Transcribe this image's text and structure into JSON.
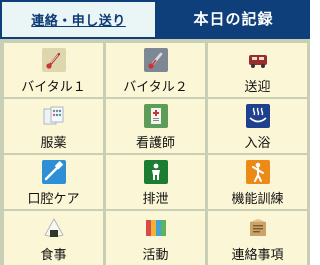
{
  "tabs": {
    "contact": "連絡・申し送り",
    "today_record": "本日の記録"
  },
  "grid": {
    "items": [
      {
        "label": "バイタル１",
        "icon": "thermometer-icon"
      },
      {
        "label": "バイタル２",
        "icon": "thermometer-icon"
      },
      {
        "label": "送迎",
        "icon": "car-icon"
      },
      {
        "label": "服薬",
        "icon": "medicine-icon"
      },
      {
        "label": "看護師",
        "icon": "nurse-icon"
      },
      {
        "label": "入浴",
        "icon": "bath-icon"
      },
      {
        "label": "口腔ケア",
        "icon": "toothbrush-icon"
      },
      {
        "label": "排泄",
        "icon": "toilet-icon"
      },
      {
        "label": "機能訓練",
        "icon": "exercise-icon"
      },
      {
        "label": "食事",
        "icon": "rice-ball-icon"
      },
      {
        "label": "活動",
        "icon": "activity-icon"
      },
      {
        "label": "連絡事項",
        "icon": "memo-icon"
      }
    ]
  }
}
